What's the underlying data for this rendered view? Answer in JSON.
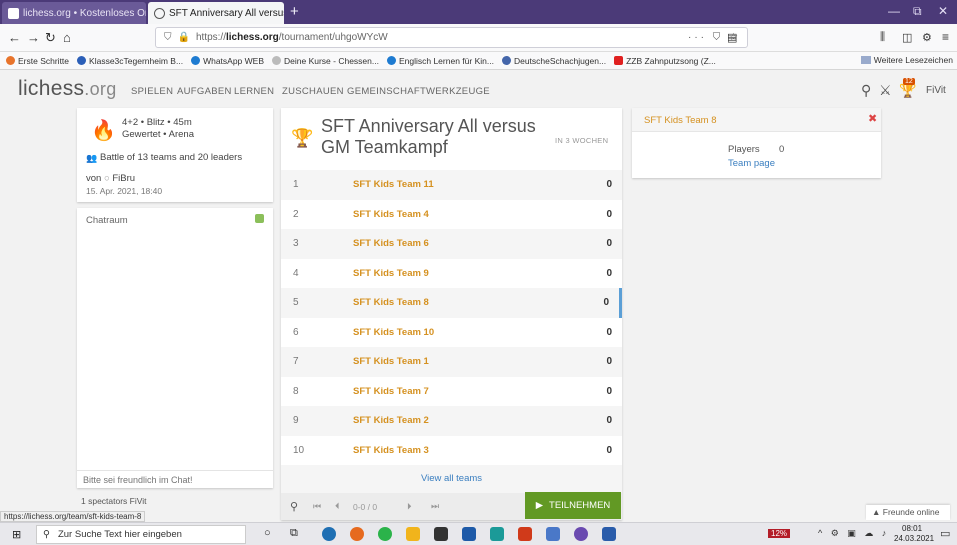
{
  "browser": {
    "tabs": [
      {
        "label": "lichess.org • Kostenloses Onlin",
        "close": "✕"
      },
      {
        "label": "SFT Anniversary All versus GM",
        "close": "✕"
      }
    ],
    "new_tab": "+",
    "url_prefix": "https://",
    "url_domain": "lichess.org",
    "url_path": "/tournament/uhgoWYcW",
    "url_actions": "··· ⛉ ☆",
    "bookmarks": [
      {
        "label": "Erste Schritte",
        "color": "#e8742c"
      },
      {
        "label": "Klasse3cTegernheim B...",
        "color": "#2b5fb8"
      },
      {
        "label": "WhatsApp WEB",
        "color": "#1e7bd1"
      },
      {
        "label": "Deine Kurse - Chessen...",
        "color": "#8aa"
      },
      {
        "label": "Englisch Lernen für Kin...",
        "color": "#1e7bd1"
      },
      {
        "label": "DeutscheSchachjugen...",
        "color": "#4466aa"
      },
      {
        "label": "ZZB Zahnputzsong (Z...",
        "color": "#e02020"
      }
    ],
    "bookmarks_more": "Weitere Lesezeichen"
  },
  "lichess": {
    "logo_main": "lichess",
    "logo_tld": ".org",
    "nav": [
      "SPIELEN",
      "AUFGABEN",
      "LERNEN",
      "ZUSCHAUEN",
      "GEMEINSCHAFT",
      "WERKZEUGE"
    ],
    "notification_count": "12",
    "username": "FiVit"
  },
  "tournament": {
    "clock": "4+2 • Blitz • 45m",
    "mode": "Gewertet • Arena",
    "battle": "Battle of 13 teams and 20 leaders",
    "by_prefix": "von",
    "creator": "FiBru",
    "date": "15. Apr. 2021, 18:40",
    "title": "SFT Anniversary All versus GM Teamkampf",
    "starts": "IN 3 WOCHEN",
    "teams": [
      {
        "rank": "1",
        "name": "SFT Kids Team 11",
        "score": "0"
      },
      {
        "rank": "2",
        "name": "SFT Kids Team 4",
        "score": "0"
      },
      {
        "rank": "3",
        "name": "SFT Kids Team 6",
        "score": "0"
      },
      {
        "rank": "4",
        "name": "SFT Kids Team 9",
        "score": "0"
      },
      {
        "rank": "5",
        "name": "SFT Kids Team 8",
        "score": "0"
      },
      {
        "rank": "6",
        "name": "SFT Kids Team 10",
        "score": "0"
      },
      {
        "rank": "7",
        "name": "SFT Kids Team 1",
        "score": "0"
      },
      {
        "rank": "8",
        "name": "SFT Kids Team 7",
        "score": "0"
      },
      {
        "rank": "9",
        "name": "SFT Kids Team 2",
        "score": "0"
      },
      {
        "rank": "10",
        "name": "SFT Kids Team 3",
        "score": "0"
      }
    ],
    "view_all": "View all teams",
    "pager": "0-0 / 0",
    "join_label": "TEILNEHMEN"
  },
  "chat": {
    "title": "Chatraum",
    "placeholder": "Bitte sei freundlich im Chat!",
    "spectators": "1 spectators FiVit"
  },
  "team_panel": {
    "name": "SFT Kids Team 8",
    "players_label": "Players",
    "players_count": "0",
    "team_page": "Team page"
  },
  "friends_online": "▲ Freunde online",
  "status_url": "https://lichess.org/team/sft-kids-team-8",
  "taskbar": {
    "search_placeholder": "Zur Suche Text hier eingeben",
    "battery": "12%",
    "time": "08:01",
    "date": "24.03.2021"
  },
  "colors": {
    "accent": "#d59120",
    "join_green": "#629924",
    "highlight": "#5b9fd6"
  }
}
